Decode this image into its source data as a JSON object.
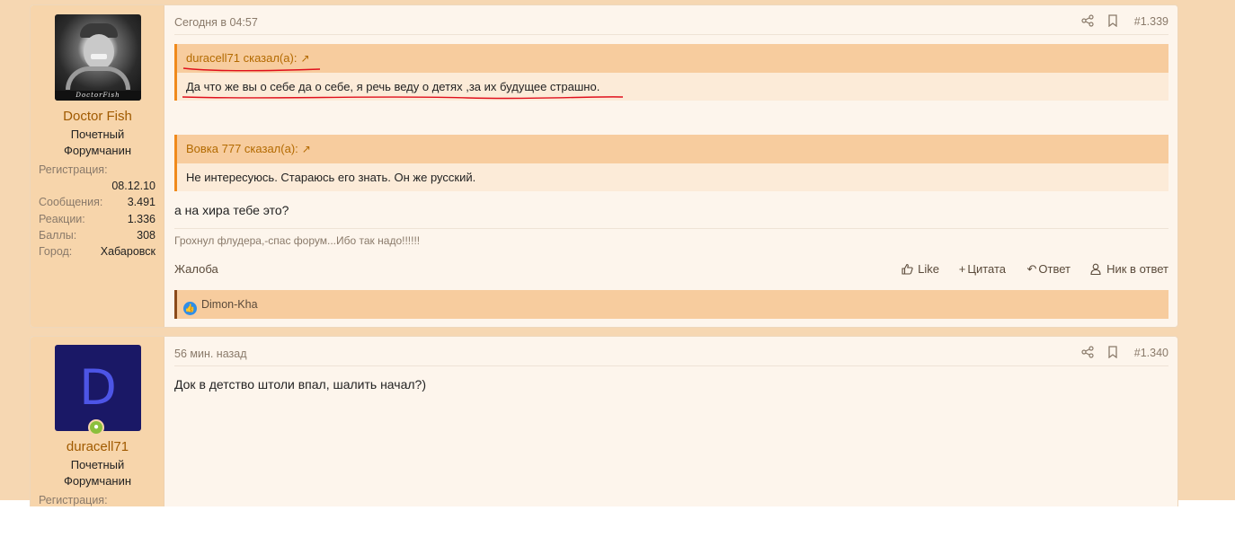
{
  "posts": [
    {
      "user": {
        "name": "Doctor Fish",
        "avatar_caption": "DoctorFish",
        "title_line1": "Почетный",
        "title_line2": "Форумчанин",
        "reg_label": "Регистрация:",
        "reg_value": "08.12.10",
        "messages_label": "Сообщения:",
        "messages_value": "3.491",
        "reactions_label": "Реакции:",
        "reactions_value": "1.336",
        "points_label": "Баллы:",
        "points_value": "308",
        "city_label": "Город:",
        "city_value": "Хабаровск"
      },
      "date": "Сегодня в 04:57",
      "number": "#1.339",
      "quotes": [
        {
          "author": "duracell71 сказал(а):",
          "text": "Да что же вы о себе да о себе, я речь веду о детях ,за их будущее страшно."
        },
        {
          "author": "Вовка 777 сказал(а):",
          "text": "Не интересуюсь. Стараюсь его знать. Он же русский."
        }
      ],
      "text": "а на хира тебе это?",
      "signature": "Грохнул флудера,-спас форум...Ибо так надо!!!!!!",
      "actions": {
        "report": "Жалоба",
        "like": "Like",
        "quote": "Цитата",
        "reply": "Ответ",
        "nick": "Ник в ответ"
      },
      "reactions_user": "Dimon-Kha"
    },
    {
      "user": {
        "name": "duracell71",
        "avatar_letter": "D",
        "title_line1": "Почетный",
        "title_line2": "Форумчанин",
        "reg_label": "Регистрация:"
      },
      "date": "56 мин. назад",
      "number": "#1.340",
      "text": "Док в детство штоли впал, шалить начал?)"
    }
  ],
  "colors": {
    "page_bg": "#f6d7b2",
    "post_bg": "#fdf5ec",
    "user_cell_bg": "#f7d5ab",
    "quote_accent": "#f08a1c",
    "link": "#a05a00",
    "annotation_red": "#e0101c"
  },
  "icons": {
    "share": "share-icon",
    "bookmark": "bookmark-icon",
    "external": "external-link-icon",
    "like": "thumbs-up-icon",
    "quote": "plus-icon",
    "reply": "reply-icon",
    "nick": "user-icon",
    "reaction": "like-reaction-icon",
    "online": "online-status-icon"
  }
}
